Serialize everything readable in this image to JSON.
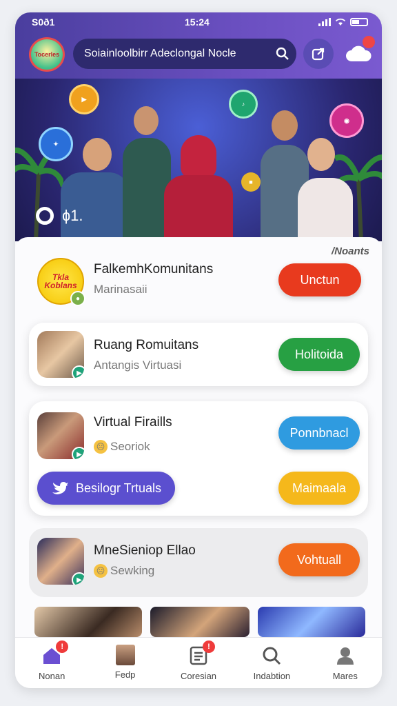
{
  "status": {
    "carrier": "S0ð1",
    "time": "15:24"
  },
  "header": {
    "logo_text": "Tocerles",
    "search_value": "Soiainloolbirr Adeclongal Nocle"
  },
  "hero": {
    "control_text": "ɸ1."
  },
  "section": {
    "label": "/Noants"
  },
  "cards": [
    {
      "title": "FalkemhKomunitans",
      "subtitle": "Marinasaii",
      "button": "Unctun",
      "button_color": "#e83a1e",
      "avatar_text": "Tkla Koblans"
    },
    {
      "title": "Ruang Romuitans",
      "subtitle": "Antangis Virtuasi",
      "button": "Holitoida",
      "button_color": "#27a043"
    },
    {
      "title": "Virtual Firaills",
      "subtitle": "Seoriok",
      "button": "Ponnbnacl",
      "button_color": "#2f9be0",
      "secondary_button": "Besilogr Trtuals",
      "secondary_color": "#5b4fcf",
      "tertiary_button": "Maimaala",
      "tertiary_color": "#f5b81b"
    },
    {
      "title": "MneSieniop Ellao",
      "subtitle": "Sewking",
      "button": "Vohtuall",
      "button_color": "#f26a1c"
    }
  ],
  "tabs": [
    {
      "label": "Nonan",
      "icon": "home-icon",
      "badge": "!"
    },
    {
      "label": "Fedp",
      "icon": "profile-photo-icon"
    },
    {
      "label": "Coresian",
      "icon": "document-icon",
      "badge": "!"
    },
    {
      "label": "Indabtion",
      "icon": "search-icon"
    },
    {
      "label": "Mares",
      "icon": "person-icon"
    }
  ]
}
